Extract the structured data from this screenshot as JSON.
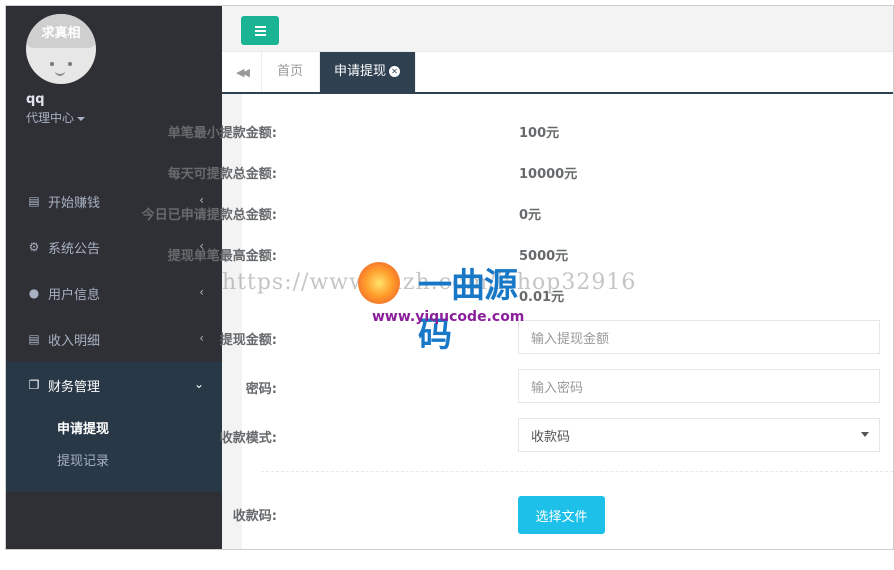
{
  "sidebar": {
    "avatar_text": "求真相",
    "username": "qq",
    "role": "代理中心",
    "menu": [
      {
        "label": "开始赚钱",
        "icon": "database-icon"
      },
      {
        "label": "系统公告",
        "icon": "gear-icon"
      },
      {
        "label": "用户信息",
        "icon": "users-icon"
      },
      {
        "label": "收入明细",
        "icon": "list-icon"
      },
      {
        "label": "财务管理",
        "icon": "copy-icon"
      }
    ],
    "submenu": [
      {
        "label": "申请提现"
      },
      {
        "label": "提现记录"
      }
    ]
  },
  "tabs": {
    "home": "首页",
    "current": "申请提现"
  },
  "form": {
    "min_single_label": "单笔最小提款金额:",
    "min_single_value": "100元",
    "daily_total_label": "每天可提款总金额:",
    "daily_total_value": "10000元",
    "today_applied_label": "今日已申请提款总金额:",
    "today_applied_value": "0元",
    "max_single_label": "提现单笔最高金额:",
    "max_single_value": "5000元",
    "balance_value": "0.01元",
    "amount_label": "提现金额:",
    "amount_placeholder": "输入提现金额",
    "password_label": "密码:",
    "password_placeholder": "输入密码",
    "mode_label": "收款模式:",
    "mode_value": "收款码",
    "qrcode_label": "收款码:",
    "file_button": "选择文件"
  },
  "watermark": {
    "url": "https://www.yuzh.com/ishop32916",
    "logo_text": "一曲源码",
    "site": "www.yiqucode.com"
  }
}
